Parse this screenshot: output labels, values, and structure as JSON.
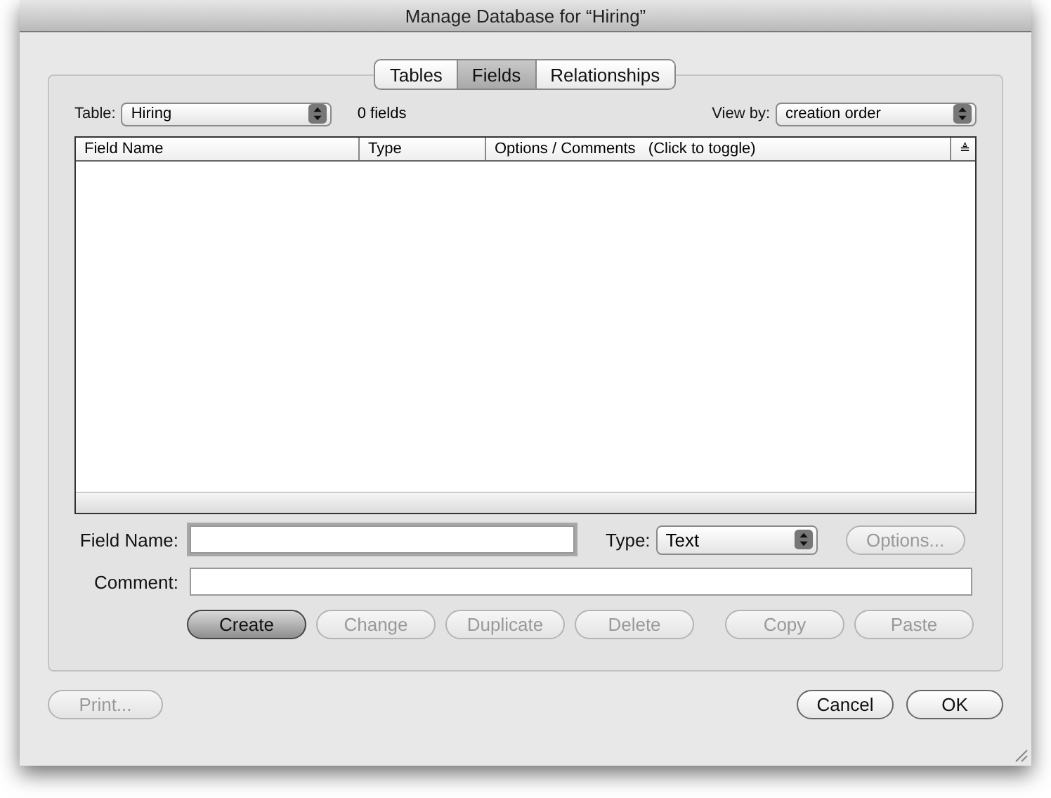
{
  "window": {
    "title": "Manage Database for “Hiring”"
  },
  "tabs": [
    {
      "label": "Tables",
      "selected": false
    },
    {
      "label": "Fields",
      "selected": true
    },
    {
      "label": "Relationships",
      "selected": false
    }
  ],
  "table_picker": {
    "label": "Table:",
    "value": "Hiring"
  },
  "field_count": "0 fields",
  "view_by": {
    "label": "View by:",
    "value": "creation order"
  },
  "table": {
    "columns": [
      "Field Name",
      "Type",
      "Options / Comments   (Click to toggle)"
    ],
    "sort_icon": "≜"
  },
  "field_name": {
    "label": "Field Name:"
  },
  "type_picker": {
    "label": "Type:",
    "value": "Text"
  },
  "options_button": {
    "label": "Options...",
    "disabled": true
  },
  "comment": {
    "label": "Comment:"
  },
  "action_buttons": [
    {
      "label": "Create",
      "disabled": false,
      "default": true
    },
    {
      "label": "Change",
      "disabled": true,
      "default": false
    },
    {
      "label": "Duplicate",
      "disabled": true,
      "default": false
    },
    {
      "label": "Delete",
      "disabled": true,
      "default": false
    },
    {
      "label": "Copy",
      "disabled": true,
      "default": false
    },
    {
      "label": "Paste",
      "disabled": true,
      "default": false
    }
  ],
  "print_button": {
    "label": "Print...",
    "disabled": true
  },
  "footer_buttons": [
    {
      "label": "Cancel",
      "disabled": false
    },
    {
      "label": "OK",
      "disabled": false
    }
  ]
}
